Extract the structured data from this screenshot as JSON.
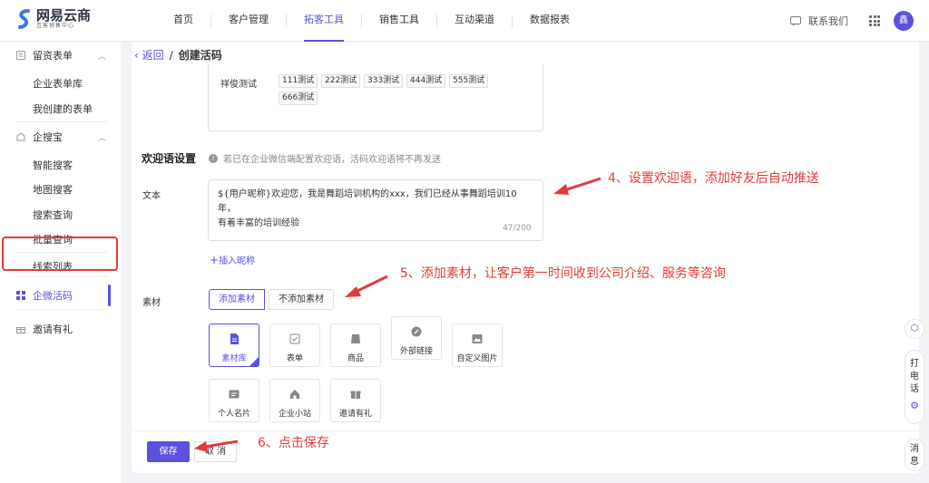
{
  "brand": {
    "title": "网易云商",
    "subtitle": "互客销售中心"
  },
  "nav": [
    "首页",
    "客户管理",
    "拓客工具",
    "销售工具",
    "互动渠道",
    "数据报表"
  ],
  "header": {
    "contact": "联系我们",
    "avatar": "鑫"
  },
  "sidebar": {
    "group1": "留资表单",
    "group1_items": [
      "企业表单库",
      "我创建的表单"
    ],
    "group2": "企搜宝",
    "group2_items": [
      "智能搜客",
      "地图搜客",
      "搜索查询",
      "批量查询"
    ],
    "item_leads": "线索列表",
    "item_active": "企微活码",
    "item_invite": "邀请有礼"
  },
  "breadcrumb": {
    "back": "返回",
    "current": "创建活码"
  },
  "tags": {
    "name": "祥俊测试",
    "items": [
      "111测试",
      "222测试",
      "333测试",
      "444测试",
      "555测试",
      "666测试"
    ]
  },
  "welcome": {
    "title": "欢迎语设置",
    "hint": "若已在企业微信端配置欢迎语，活码欢迎语将不再发送",
    "text_label": "文本",
    "text_line1": "${用户昵称}欢迎您，我是舞蹈培训机构的xxx，我们已经从事舞蹈培训10年，",
    "text_line2": "有着丰富的培训经验",
    "count": "47/200",
    "insert": "插入昵称"
  },
  "material": {
    "label": "素材",
    "add": "添加素材",
    "no_add": "不添加素材",
    "cards": [
      "素材库",
      "表单",
      "商品",
      "外部链接",
      "自定义图片",
      "个人名片",
      "企业小站",
      "邀请有礼"
    ]
  },
  "buttons": {
    "save": "保存",
    "cancel": "取 消"
  },
  "annotations": {
    "a4": "4、设置欢迎语，添加好友后自动推送",
    "a5": "5、添加素材，让客户第一时间收到公司介绍、服务等咨询",
    "a6": "6、点击保存"
  },
  "float": {
    "phone": [
      "打",
      "电",
      "话"
    ],
    "msg": [
      "消",
      "息"
    ]
  },
  "colors": {
    "accent": "#5a51e0",
    "annotation": "#e23b3b"
  }
}
